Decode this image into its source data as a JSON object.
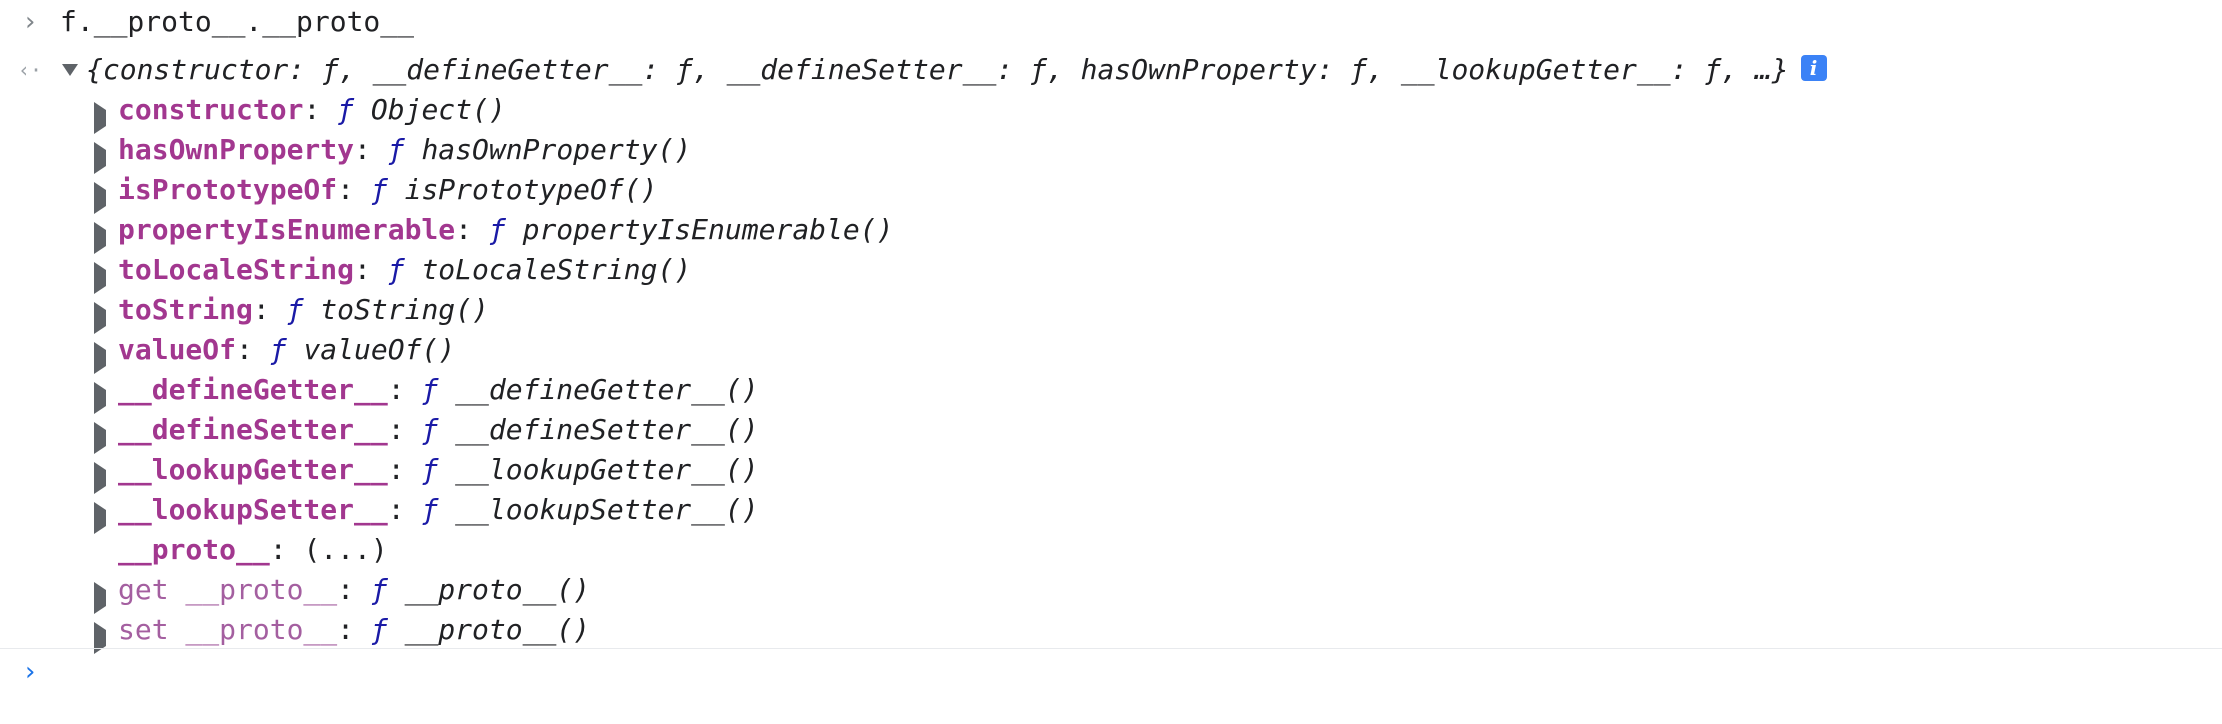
{
  "input": {
    "expression": "f.__proto__.__proto__"
  },
  "result": {
    "summary": "{constructor: ƒ, __defineGetter__: ƒ, __defineSetter__: ƒ, hasOwnProperty: ƒ, __lookupGetter__: ƒ, …}",
    "properties": [
      {
        "key": "constructor",
        "sep": ": ",
        "sym": "ƒ ",
        "value": "Object()"
      },
      {
        "key": "hasOwnProperty",
        "sep": ": ",
        "sym": "ƒ ",
        "value": "hasOwnProperty()"
      },
      {
        "key": "isPrototypeOf",
        "sep": ": ",
        "sym": "ƒ ",
        "value": "isPrototypeOf()"
      },
      {
        "key": "propertyIsEnumerable",
        "sep": ": ",
        "sym": "ƒ ",
        "value": "propertyIsEnumerable()"
      },
      {
        "key": "toLocaleString",
        "sep": ": ",
        "sym": "ƒ ",
        "value": "toLocaleString()"
      },
      {
        "key": "toString",
        "sep": ": ",
        "sym": "ƒ ",
        "value": "toString()"
      },
      {
        "key": "valueOf",
        "sep": ": ",
        "sym": "ƒ ",
        "value": "valueOf()"
      },
      {
        "key": "__defineGetter__",
        "sep": ": ",
        "sym": "ƒ ",
        "value": "__defineGetter__()"
      },
      {
        "key": "__defineSetter__",
        "sep": ": ",
        "sym": "ƒ ",
        "value": "__defineSetter__()"
      },
      {
        "key": "__lookupGetter__",
        "sep": ": ",
        "sym": "ƒ ",
        "value": "__lookupGetter__()"
      },
      {
        "key": "__lookupSetter__",
        "sep": ": ",
        "sym": "ƒ ",
        "value": "__lookupSetter__()"
      },
      {
        "key": "__proto__",
        "sep": ": ",
        "value": "(...)"
      },
      {
        "key": "get __proto__",
        "sep": ": ",
        "sym": "ƒ ",
        "value": "__proto__()"
      },
      {
        "key": "set __proto__",
        "sep": ": ",
        "sym": "ƒ ",
        "value": "__proto__()"
      }
    ]
  },
  "icons": {
    "input_chevron": "›",
    "result_arrow": "‹·",
    "prompt_chevron": "›",
    "info": "i"
  },
  "colors": {
    "key": "#a2378f",
    "accessor_key": "#a45fa0",
    "function_symbol": "#1a1aa6",
    "prompt": "#1a73e8",
    "info_badge": "#3b82f6"
  }
}
